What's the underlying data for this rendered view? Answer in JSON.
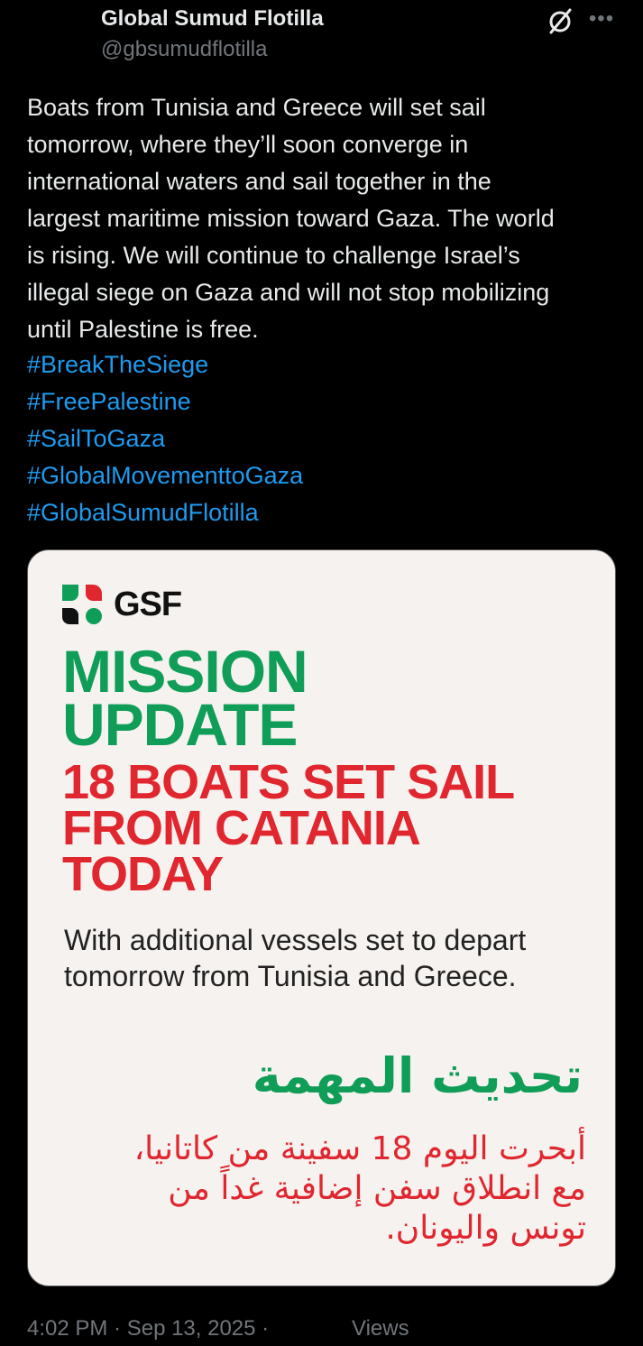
{
  "post": {
    "author_name": "Global Sumud Flotilla",
    "author_handle": "@gbsumudflotilla",
    "text": "Boats from Tunisia and Greece will set sail\ntomorrow, where they’ll soon converge in\ninternational waters and sail together in the\nlargest maritime mission toward Gaza. The world\nis rising. We will continue to challenge Israel’s\nillegal siege on Gaza and will not stop mobilizing\nuntil Palestine is free.",
    "hashtags": [
      "#BreakTheSiege",
      "#FreePalestine",
      "#SailToGaza",
      "#GlobalMovementtoGaza",
      "#GlobalSumudFlotilla"
    ],
    "timestamp": "4:02 PM · Sep 13, 2025 ·",
    "views_label": "Views"
  },
  "media": {
    "logo_text": "GSF",
    "headline": "MISSION\nUPDATE",
    "subhead": "18 BOATS SET SAIL\nFROM CATANIA\nTODAY",
    "description": "With additional vessels set to depart\ntomorrow from Tunisia and Greece.",
    "arabic_title": "تحديث المهمة",
    "arabic_body": "أبحرت اليوم 18 سفينة من كاتانيا،\nمع انطلاق سفن إضافية غداً من\nتونس واليونان."
  },
  "icons": {
    "grok": "grok-icon",
    "more": "more-options-icon",
    "logo": "gsf-logo-icon"
  },
  "colors": {
    "background": "#000000",
    "text": "#e7e9ea",
    "secondary_text": "#71767b",
    "link": "#1d9bf0",
    "card_background": "#f6f2ef",
    "green": "#0f9d58",
    "red": "#e0262f"
  }
}
